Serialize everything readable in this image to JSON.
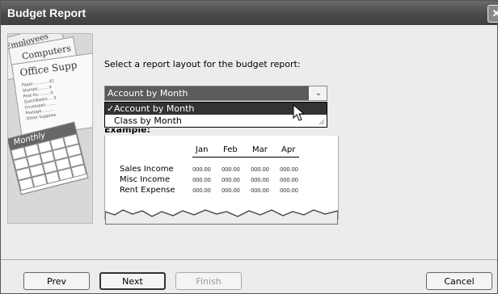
{
  "window": {
    "title": "Budget Report",
    "close_glyph": "✕"
  },
  "side_art": {
    "papers": [
      "Employees",
      "Computers",
      "Office Supp"
    ],
    "list_lines": [
      "Paper.............$1",
      "Stamps.........$",
      "Post-its..........$",
      "QuickBooks.....$",
      "Envelopes.........",
      "Postage..........",
      "Other Supplies"
    ],
    "calendar_label": "Monthly"
  },
  "form": {
    "prompt": "Select a report layout for the budget report:",
    "layout_select": {
      "value": "Account by Month",
      "arrow": "⌄",
      "options": [
        {
          "label": "Account by Month",
          "selected": true,
          "check": "✓"
        },
        {
          "label": "Class by Month",
          "selected": false,
          "check": ""
        }
      ]
    },
    "example_label": "Example:"
  },
  "preview": {
    "months": [
      "Jan",
      "Feb",
      "Mar",
      "Apr"
    ],
    "rows": [
      "Sales Income",
      "Misc Income",
      "Rent Expense"
    ],
    "cell_value": "000.00"
  },
  "buttons": {
    "prev": "Prev",
    "next": "Next",
    "finish": "Finish",
    "cancel": "Cancel"
  }
}
